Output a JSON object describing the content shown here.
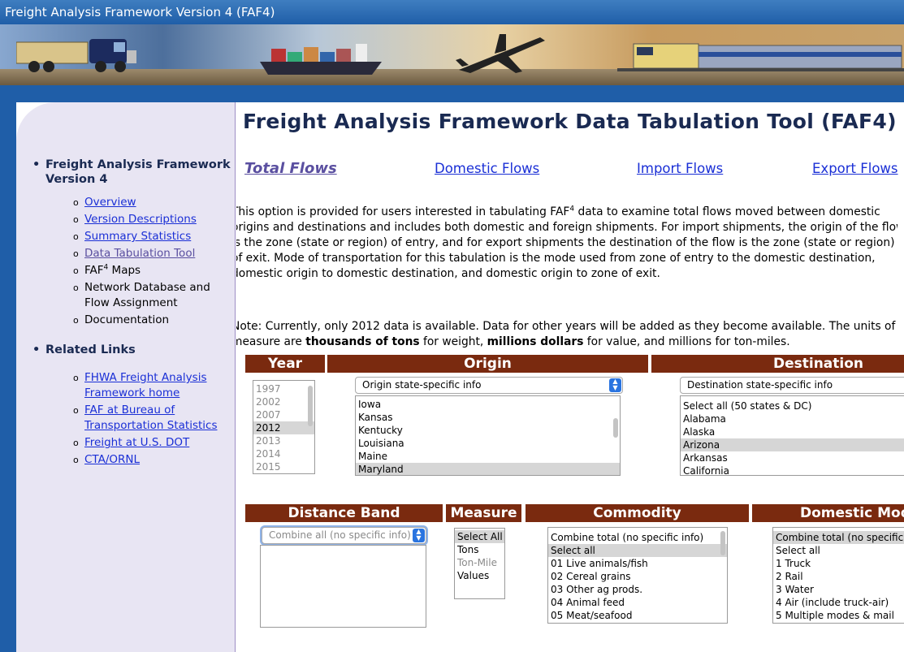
{
  "header": {
    "title": "Freight Analysis Framework Version 4 (FAF4)"
  },
  "sidebar": {
    "sections": [
      {
        "label": "Freight Analysis Framework Version 4",
        "items": [
          {
            "label": "Overview"
          },
          {
            "label": "Version Descriptions"
          },
          {
            "label": "Summary Statistics"
          },
          {
            "label": "Data Tabulation Tool"
          },
          {
            "label_pre": "FAF",
            "label_sup": "4",
            "label_post": " Maps"
          },
          {
            "label": "Network Database and Flow Assignment"
          },
          {
            "label": "Documentation"
          }
        ]
      },
      {
        "label": "Related Links",
        "items": [
          {
            "label": "FHWA Freight Analysis Framework home"
          },
          {
            "label": "FAF at Bureau of Transportation Statistics"
          },
          {
            "label": "Freight at U.S. DOT"
          },
          {
            "label": "CTA/ORNL"
          }
        ]
      }
    ]
  },
  "main": {
    "title": "Freight Analysis Framework Data Tabulation Tool (FAF4)",
    "tabs": [
      "Total Flows",
      "Domestic Flows",
      "Import Flows",
      "Export Flows"
    ],
    "description": {
      "line1_pre": "This option is provided for users interested in tabulating FAF",
      "line1_sup": "4",
      "line1_post": " data to examine total flows moved between domestic",
      "line2": "origins and destinations and includes both domestic and foreign shipments. For import shipments, the origin of the flow",
      "line3": "is the zone (state or region) of entry, and for export shipments the destination of the flow is the zone (state or region)",
      "line4": "of exit. Mode of transportation for this tabulation is the mode used from zone of entry to the domestic destination,",
      "line5": "domestic origin to domestic destination, and domestic origin to zone of exit."
    },
    "note": {
      "line1": "Note: Currently, only 2012 data is available. Data for other years will be added as they become available. The units of",
      "line2_a": "measure are ",
      "line2_b": "thousands of tons",
      "line2_c": " for weight, ",
      "line2_d": "millions dollars",
      "line2_e": " for value, and millions for ton-miles."
    }
  },
  "form": {
    "year": {
      "header": "Year",
      "options": [
        "1997",
        "2002",
        "2007",
        "2012",
        "2013",
        "2014",
        "2015"
      ],
      "selected": "2012"
    },
    "origin": {
      "header": "Origin",
      "dropdown": "Origin state-specific info",
      "options": [
        "Iowa",
        "Kansas",
        "Kentucky",
        "Louisiana",
        "Maine",
        "Maryland"
      ],
      "selected": "Maryland"
    },
    "destination": {
      "header": "Destination",
      "dropdown": "Destination state-specific info",
      "options": [
        "Select all (50 states & DC)",
        "Alabama",
        "Alaska",
        "Arizona",
        "Arkansas",
        "California"
      ],
      "selected": "Arizona"
    },
    "distance_band": {
      "header": "Distance Band",
      "dropdown": "Combine all (no specific info)"
    },
    "measure": {
      "header": "Measure",
      "options": [
        "Select All",
        "Tons",
        "Ton-Mile",
        "Values"
      ],
      "selected": "Select All",
      "disabled": "Ton-Mile"
    },
    "commodity": {
      "header": "Commodity",
      "options": [
        "Combine total (no specific info)",
        "Select all",
        "01 Live animals/fish",
        "02 Cereal grains",
        "03 Other ag prods.",
        "04 Animal feed",
        "05 Meat/seafood"
      ],
      "selected": "Select all"
    },
    "domestic_mode": {
      "header": "Domestic Mode",
      "options": [
        "Combine total (no specific info)",
        "Select all",
        "1 Truck",
        "2 Rail",
        "3 Water",
        "4 Air (include truck-air)",
        "5 Multiple modes & mail"
      ],
      "selected": "Combine total (no specific info)"
    }
  },
  "colors": {
    "header_bar": "#1f5ea8",
    "sidebar_bg": "#e8e5f3",
    "table_header": "#7a2a0f",
    "link": "#1a2fd6",
    "visited_link": "#5a4fa0",
    "title_text": "#1a2a52"
  }
}
